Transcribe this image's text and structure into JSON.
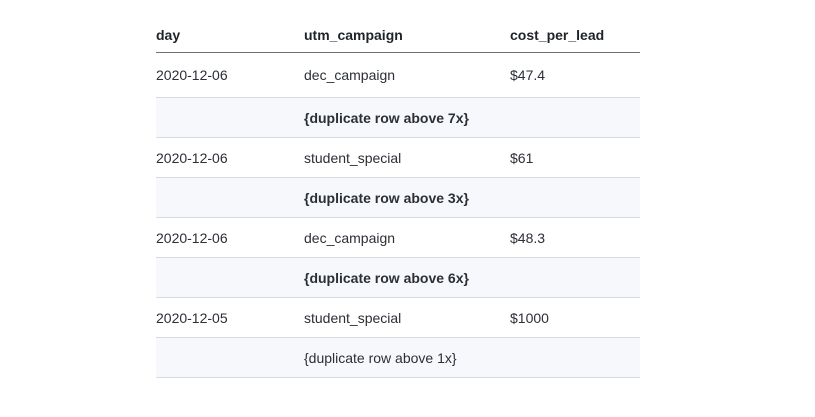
{
  "table": {
    "headers": [
      "day",
      "utm_campaign",
      "cost_per_lead"
    ],
    "rows": [
      {
        "type": "data",
        "day": "2020-12-06",
        "utm_campaign": "dec_campaign",
        "cost_per_lead": "$47.4"
      },
      {
        "type": "dup",
        "text": "{duplicate row above 7x}"
      },
      {
        "type": "data",
        "day": "2020-12-06",
        "utm_campaign": "student_special",
        "cost_per_lead": "$61"
      },
      {
        "type": "dup",
        "text": "{duplicate row above 3x}"
      },
      {
        "type": "data",
        "day": "2020-12-06",
        "utm_campaign": "dec_campaign",
        "cost_per_lead": "$48.3"
      },
      {
        "type": "dup",
        "text": "{duplicate row above 6x}"
      },
      {
        "type": "data",
        "day": "2020-12-05",
        "utm_campaign": "student_special",
        "cost_per_lead": "$1000"
      },
      {
        "type": "dup",
        "text": "{duplicate row above 1x}"
      }
    ]
  }
}
